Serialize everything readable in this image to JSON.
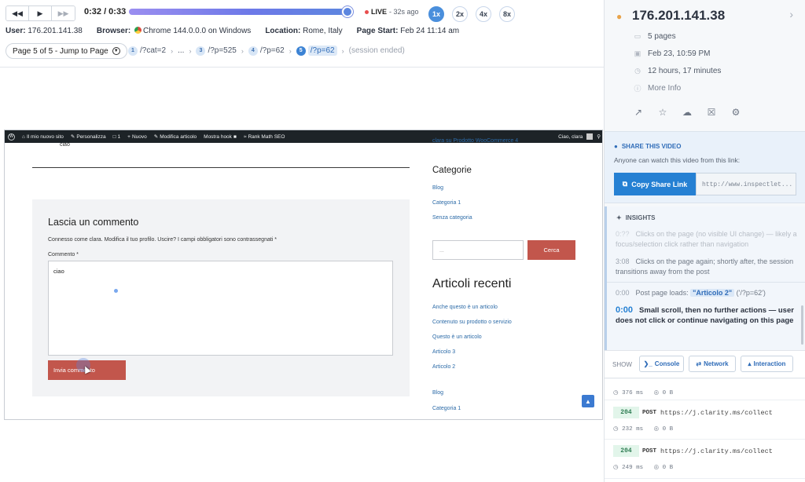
{
  "player": {
    "rewind_icon": "rewind-icon",
    "play_icon": "play-icon",
    "forward_icon": "fast-forward-icon",
    "time": "0:32 / 0:33",
    "progress": 0.97,
    "live_label": "LIVE",
    "live_ago": "- 32s ago",
    "speeds": [
      "1x",
      "2x",
      "4x",
      "8x"
    ],
    "active_speed": "1x"
  },
  "meta": {
    "user_label": "User:",
    "user_value": "176.201.141.38",
    "browser_label": "Browser:",
    "browser_value": "Chrome 144.0.0.0 on Windows",
    "location_label": "Location:",
    "location_value": "Rome, Italy",
    "start_label": "Page Start:",
    "start_value": "Feb 24 11:14 am"
  },
  "jump": {
    "label": "Page 5 of 5 - Jump to Page"
  },
  "crumbs": [
    {
      "num": "1",
      "text": "/?cat=2"
    },
    {
      "num": "",
      "text": "..."
    },
    {
      "num": "3",
      "text": "/?p=525"
    },
    {
      "num": "4",
      "text": "/?p=62"
    },
    {
      "num": "5",
      "text": "/?p=62"
    }
  ],
  "crumbs_end": "(session ended)",
  "site": {
    "adminbar": {
      "site_name": "Il mio nuovo sito",
      "customize": "Personalizza",
      "comments": "1",
      "new": "Nuovo",
      "edit": "Modifica articolo",
      "hooks": "Mostra hook",
      "seo": "Rank Math SEO",
      "greeting": "Ciao, clara"
    },
    "ciao_top": "ciao",
    "comment_title": "Lascia un commento",
    "comment_notice": "Connesso come clara. Modifica il tuo profilo. Uscire? I campi obbligatori sono contrassegnati *",
    "comment_label": "Commento *",
    "comment_text": "ciao",
    "submit_label": "Invia commento",
    "sidebar_top": "clara su Prodotto WooCommerce 4",
    "categories_title": "Categorie",
    "categories": [
      "Blog",
      "Categoria 1",
      "Senza categoria"
    ],
    "search_placeholder": "...",
    "search_button": "Cerca",
    "recent_title": "Articoli recenti",
    "recent": [
      "Anche questo è un articolo",
      "Contenuto su prodotto o servizio",
      "Questo è un articolo",
      "Articolo 3",
      "Articolo 2"
    ],
    "bottom_links": [
      "Blog",
      "Categoria 1"
    ],
    "totop_icon": "arrow-up-icon"
  },
  "panel": {
    "ip": "176.201.141.38",
    "pages": "5 pages",
    "date": "Feb 23, 10:59 PM",
    "duration": "12 hours, 17 minutes",
    "more": "More Info",
    "share_title": "SHARE THIS VIDEO",
    "share_desc": "Anyone can watch this video from this link:",
    "copy_label": "Copy Share Link",
    "share_url": "http://www.inspectlet...",
    "insights_title": "INSIGHTS",
    "insights": [
      {
        "t": "0:??",
        "text": "Clicks on the page (no visible UI change) — likely a focus/selection click rather than navigation"
      },
      {
        "t": "3:08",
        "text": "Clicks on the page again; shortly after, the session transitions away from the post"
      }
    ],
    "load_t": "0:00",
    "load_text": "Post page loads:",
    "load_pill": "\"Articolo 2\"",
    "load_path": "('/?p=62')",
    "current_t": "0:00",
    "current_text": "Small scroll, then no further actions — user does not click or continue navigating on this page",
    "show_label": "SHOW",
    "filters": [
      "Console",
      "Network",
      "Interaction"
    ],
    "requests": [
      {
        "status": "",
        "method": "",
        "url": "",
        "ms": "376 ms",
        "size": "0 B"
      },
      {
        "status": "204",
        "method": "POST",
        "url": "https://j.clarity.ms/collect",
        "ms": "232 ms",
        "size": "0 B"
      },
      {
        "status": "204",
        "method": "POST",
        "url": "https://j.clarity.ms/collect",
        "ms": "249 ms",
        "size": "0 B"
      }
    ]
  }
}
